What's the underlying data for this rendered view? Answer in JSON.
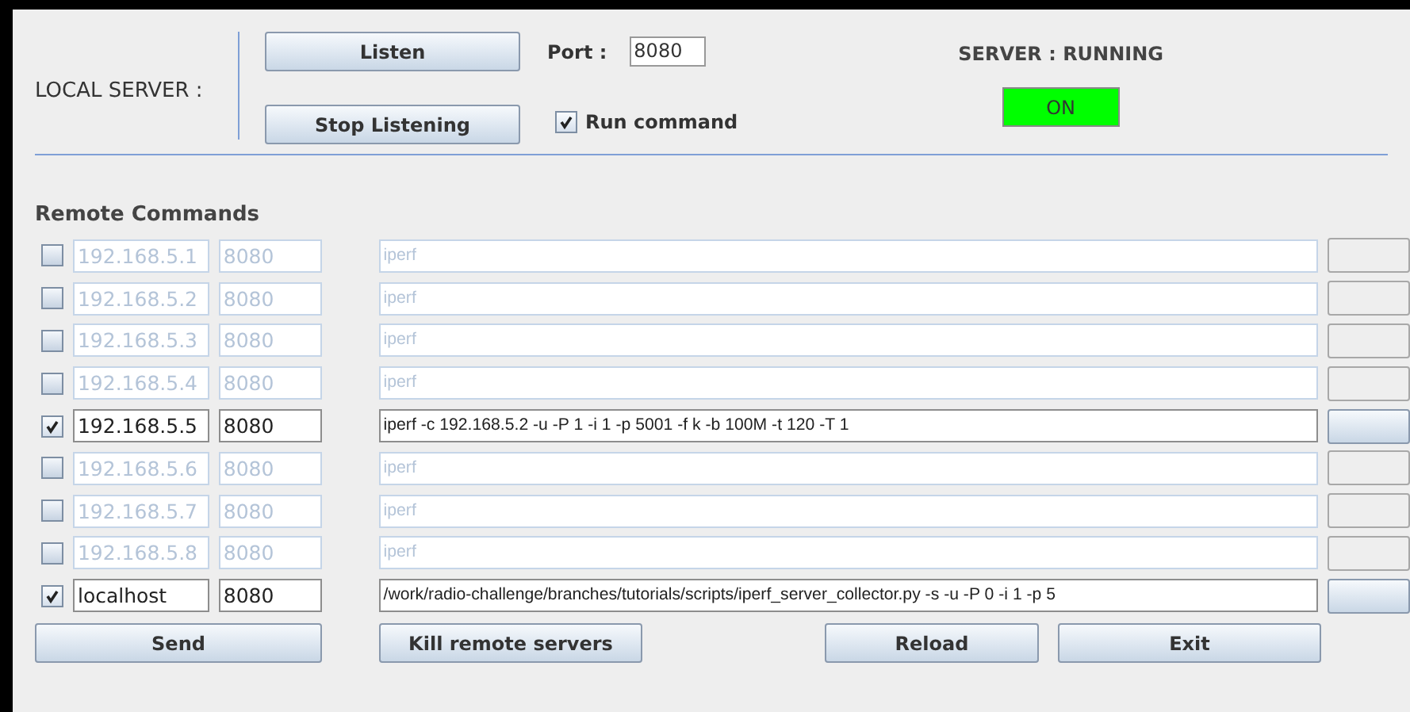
{
  "local_server": {
    "label": "LOCAL SERVER :",
    "buttons": [
      "Listen",
      "Stop Listening"
    ],
    "port_label": "Port :",
    "port_value": "8080",
    "run_command": {
      "label": "Run command",
      "checked": true
    },
    "status_label": "SERVER : RUNNING",
    "status_indicator": {
      "text": "ON",
      "on": true
    }
  },
  "remote_commands": {
    "title": "Remote Commands",
    "rows": [
      {
        "checked": false,
        "host": "192.168.5.1",
        "port": "8080",
        "command": "iperf"
      },
      {
        "checked": false,
        "host": "192.168.5.2",
        "port": "8080",
        "command": "iperf"
      },
      {
        "checked": false,
        "host": "192.168.5.3",
        "port": "8080",
        "command": "iperf"
      },
      {
        "checked": false,
        "host": "192.168.5.4",
        "port": "8080",
        "command": "iperf"
      },
      {
        "checked": true,
        "host": "192.168.5.5",
        "port": "8080",
        "command": "iperf -c 192.168.5.2 -u -P 1 -i 1 -p 5001 -f k -b 100M -t 120 -T 1"
      },
      {
        "checked": false,
        "host": "192.168.5.6",
        "port": "8080",
        "command": "iperf"
      },
      {
        "checked": false,
        "host": "192.168.5.7",
        "port": "8080",
        "command": "iperf"
      },
      {
        "checked": false,
        "host": "192.168.5.8",
        "port": "8080",
        "command": "iperf"
      },
      {
        "checked": true,
        "host": "localhost",
        "port": "8080",
        "command": "/work/radio-challenge/branches/tutorials/scripts/iperf_server_collector.py -s -u -P 0 -i 1 -p 5"
      }
    ]
  },
  "buttons": [
    "Send",
    "Kill remote servers",
    "Reload",
    "Exit"
  ]
}
